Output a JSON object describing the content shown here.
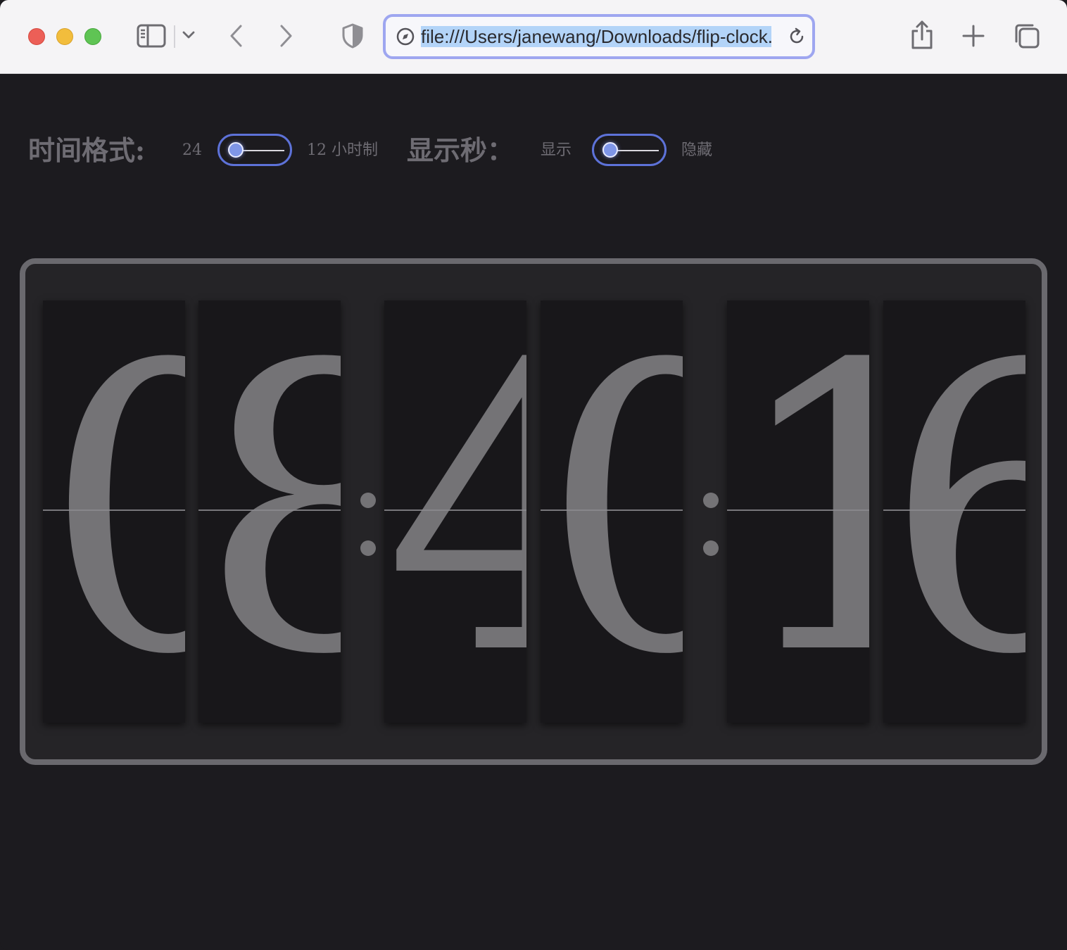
{
  "browser": {
    "url": "file:///Users/janewang/Downloads/flip-clock.html",
    "icons": [
      "sidebar-icon",
      "chevron-down-icon",
      "back-arrow-icon",
      "forward-arrow-icon",
      "shield-icon",
      "compass-icon",
      "reload-icon",
      "share-icon",
      "plus-icon",
      "tabs-icon"
    ]
  },
  "controls": {
    "time_format_label": "时间格式:",
    "format_left": "24",
    "format_right": "12 小时制",
    "show_seconds_label": "显示秒：",
    "seconds_left": "显示",
    "seconds_right": "隐藏"
  },
  "clock": {
    "hours": [
      "0",
      "8"
    ],
    "minutes": [
      "4",
      "0"
    ],
    "seconds": [
      "1",
      "6"
    ],
    "separator": ":"
  },
  "colors": {
    "background": "#1c1b1f",
    "digit_color": "#747376",
    "switch_accent": "#5d72d8",
    "url_focus": "#9ea6f0"
  }
}
